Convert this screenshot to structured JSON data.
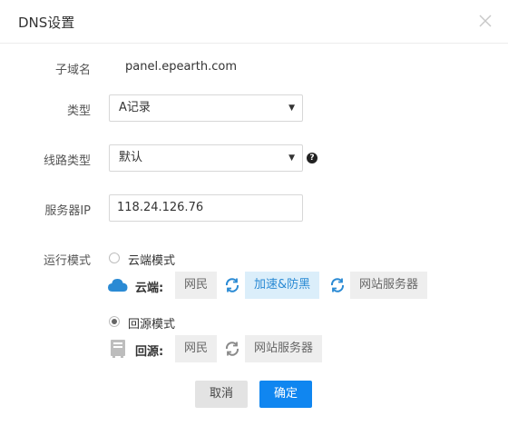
{
  "dialog": {
    "title": "DNS设置"
  },
  "form": {
    "subdomain": {
      "label": "子域名",
      "value": "panel.epearth.com"
    },
    "type": {
      "label": "类型",
      "value": "A记录"
    },
    "line_type": {
      "label": "线路类型",
      "value": "默认"
    },
    "server_ip": {
      "label": "服务器IP",
      "value": "118.24.126.76"
    },
    "run_mode": {
      "label": "运行模式",
      "options": [
        {
          "label": "云端模式",
          "checked": false
        },
        {
          "label": "回源模式",
          "checked": true
        }
      ],
      "cloud_flow": {
        "label": "云端:",
        "nodes": [
          "网民",
          "加速&防黑",
          "网站服务器"
        ]
      },
      "origin_flow": {
        "label": "回源:",
        "nodes": [
          "网民",
          "网站服务器"
        ]
      }
    }
  },
  "footer": {
    "cancel_label": "取消",
    "ok_label": "确定"
  },
  "colors": {
    "primary": "#1086f0",
    "cloud_blue": "#2a8ad4",
    "active_chip_bg": "#dbeefa",
    "chip_bg": "#eeeeee"
  },
  "icons": {
    "close": "close-icon",
    "help": "question-circle-icon",
    "cloud": "cloud-icon",
    "server": "server-icon",
    "sync_active": "sync-icon",
    "sync_inactive": "sync-icon"
  }
}
